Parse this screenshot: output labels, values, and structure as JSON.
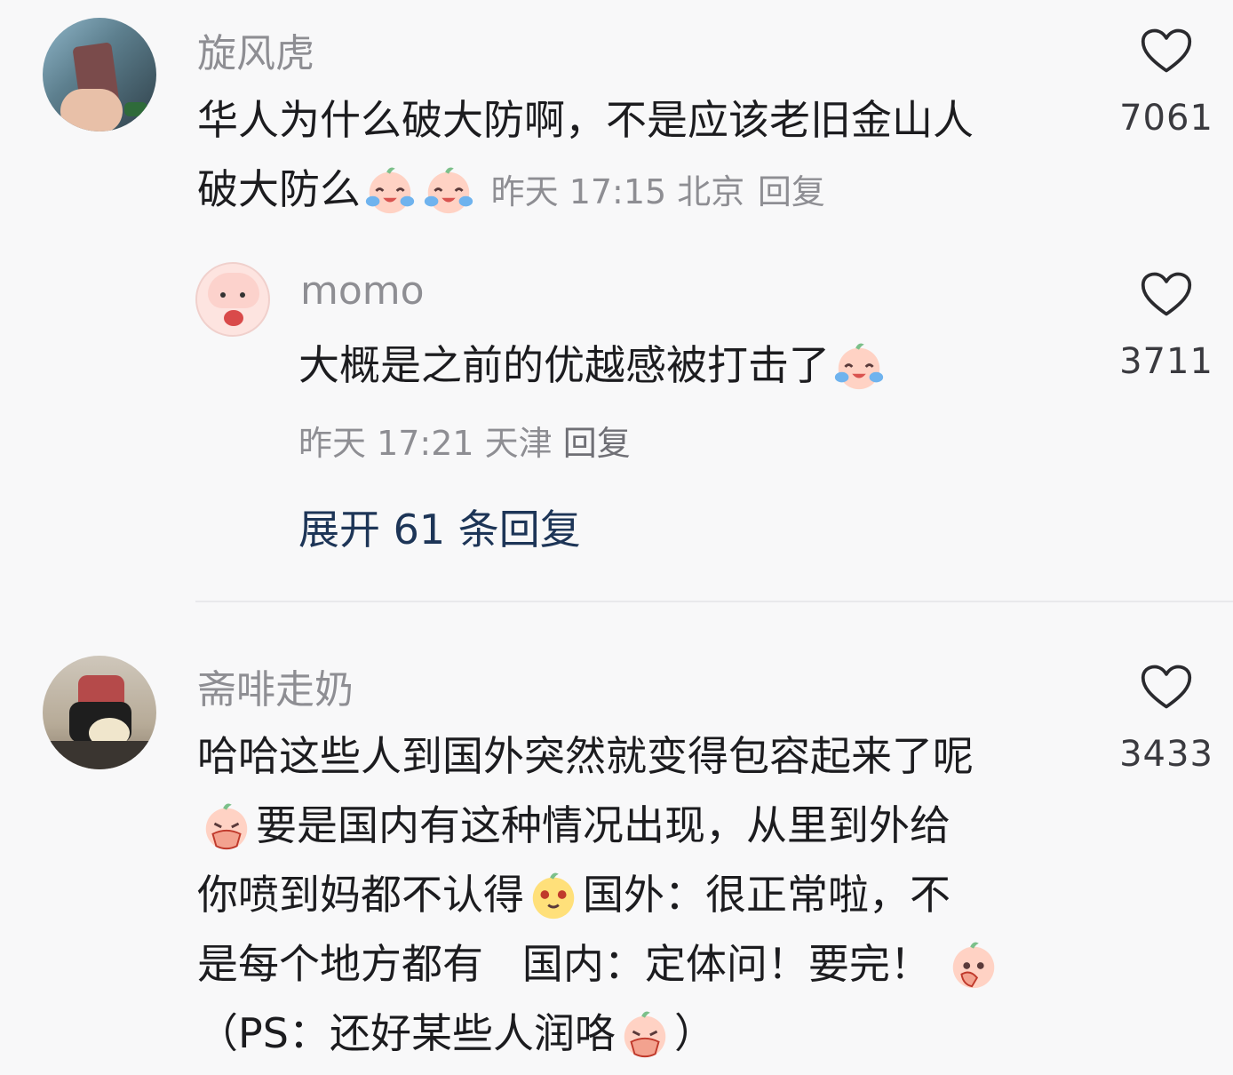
{
  "comments": [
    {
      "username": "旋风虎",
      "text_line1": "华人为什么破大防啊，不是应该老旧金山人",
      "text_line2": "破大防么",
      "meta": "昨天 17:15 北京",
      "reply_label": "回复",
      "likes": "7061"
    },
    {
      "username": "momo",
      "text": "大概是之前的优越感被打击了",
      "meta": "昨天 17:21 天津",
      "reply_label": "回复",
      "likes": "3711"
    },
    {
      "username": "斋啡走奶",
      "line1": "哈哈这些人到国外突然就变得包容起来了呢",
      "line2": "要是国内有这种情况出现，从里到外给",
      "line3a": "你喷到妈都不认得",
      "line3b": "国外：很正常啦，不",
      "line4": "是每个地方都有   国内：定体问！要完！",
      "line5a": "（PS：还好某些人润咯",
      "line5b": "）",
      "likes": "3433"
    }
  ],
  "expand_label": "展开 61 条回复",
  "icons": {
    "like": "heart-outline-icon",
    "emoji_cry": "laugh-cry-emoji-icon",
    "emoji_cover": "cover-mouth-emoji-icon",
    "emoji_smug": "smug-emoji-icon",
    "emoji_facepalm": "facepalm-emoji-icon"
  },
  "colors": {
    "background": "#f8f8f9",
    "text": "#1c1c1f",
    "secondary": "#8e8e93",
    "link": "#1d3557"
  }
}
